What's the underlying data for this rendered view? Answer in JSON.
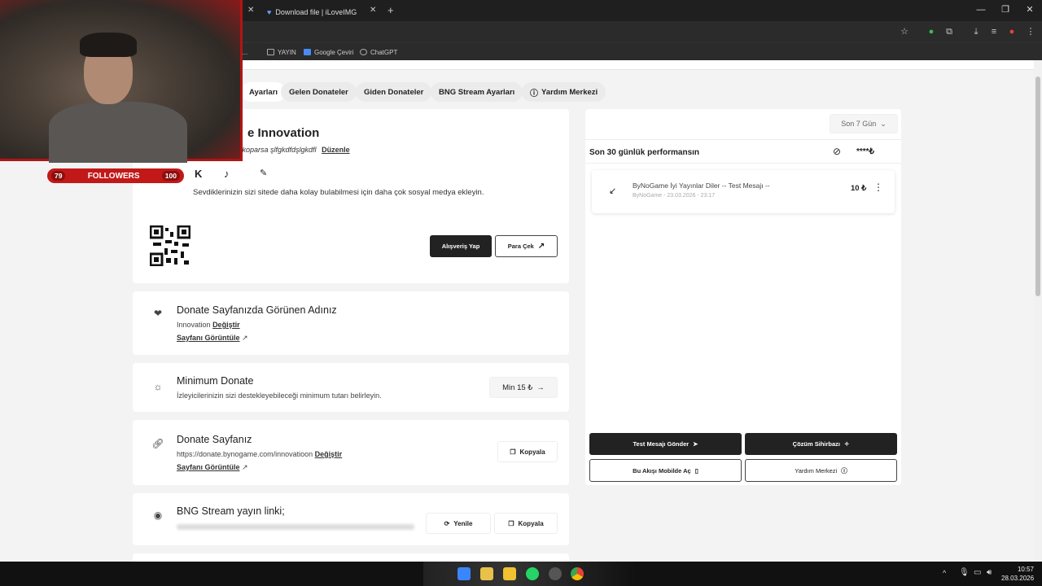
{
  "browser": {
    "tabs": [
      {
        "title": "Download file | iLoveIMG"
      }
    ],
    "bookmarks": [
      {
        "label": "YAYIN"
      },
      {
        "label": "Google Çeviri"
      },
      {
        "label": "ChatGPT"
      }
    ],
    "bookmark_partial": "Sı..."
  },
  "nav": {
    "tabs": [
      {
        "label": "Ayarları"
      },
      {
        "label": "Gelen Donateler"
      },
      {
        "label": "Giden Donateler"
      },
      {
        "label": "BNG Stream Ayarları"
      },
      {
        "label": "Yardım Merkezi"
      }
    ]
  },
  "profile": {
    "name_suffix": "e Innovation",
    "bio": "ne koparsa şlfgkdfdşlgkdfl",
    "edit_link": "Düzenle",
    "social_hint": "Sevdiklerinizin sizi sitede daha kolay bulabilmesi için daha çok sosyal medya ekleyin.",
    "shop_button": "Alışveriş Yap",
    "withdraw_button": "Para Çek"
  },
  "display_name": {
    "title": "Donate Sayfanızda Görünen Adınız",
    "value": "Innovation",
    "change_link": "Değiştir",
    "view_link": "Sayfanı Görüntüle"
  },
  "min_donate": {
    "title": "Minimum Donate",
    "subtitle": "İzleyicilerinizin sizi destekleyebileceği minimum tutarı belirleyin.",
    "button": "Min 15 ₺"
  },
  "donate_page": {
    "title": "Donate Sayfanız",
    "url": "https://donate.bynogame.com/innovatioon",
    "change_link": "Değiştir",
    "view_link": "Sayfanı Görüntüle",
    "copy_button": "Kopyala"
  },
  "stream_link": {
    "title": "BNG Stream yayın linki;",
    "refresh_button": "Yenile",
    "copy_button": "Kopyala"
  },
  "performance": {
    "range_select": "Son 7 Gün",
    "title": "Son 30 günlük performansın",
    "hidden_amount": "****₺",
    "items": [
      {
        "title": "ByNoGame İyi Yayınlar Diler -- Test Mesajı --",
        "meta": "ByNoGame - 23.03.2026 - 23:17",
        "amount": "10 ₺"
      }
    ],
    "buttons": {
      "test": "Test Mesajı Gönder",
      "wizard": "Çözüm Sihirbazı",
      "mobile": "Bu Akışı Mobilde Aç",
      "help": "Yardım Merkezi"
    }
  },
  "overlay": {
    "followers_label": "FOLLOWERS",
    "left_count": "79",
    "right_count": "100"
  },
  "taskbar": {
    "time": "10:57",
    "date": "28.03.2026"
  }
}
